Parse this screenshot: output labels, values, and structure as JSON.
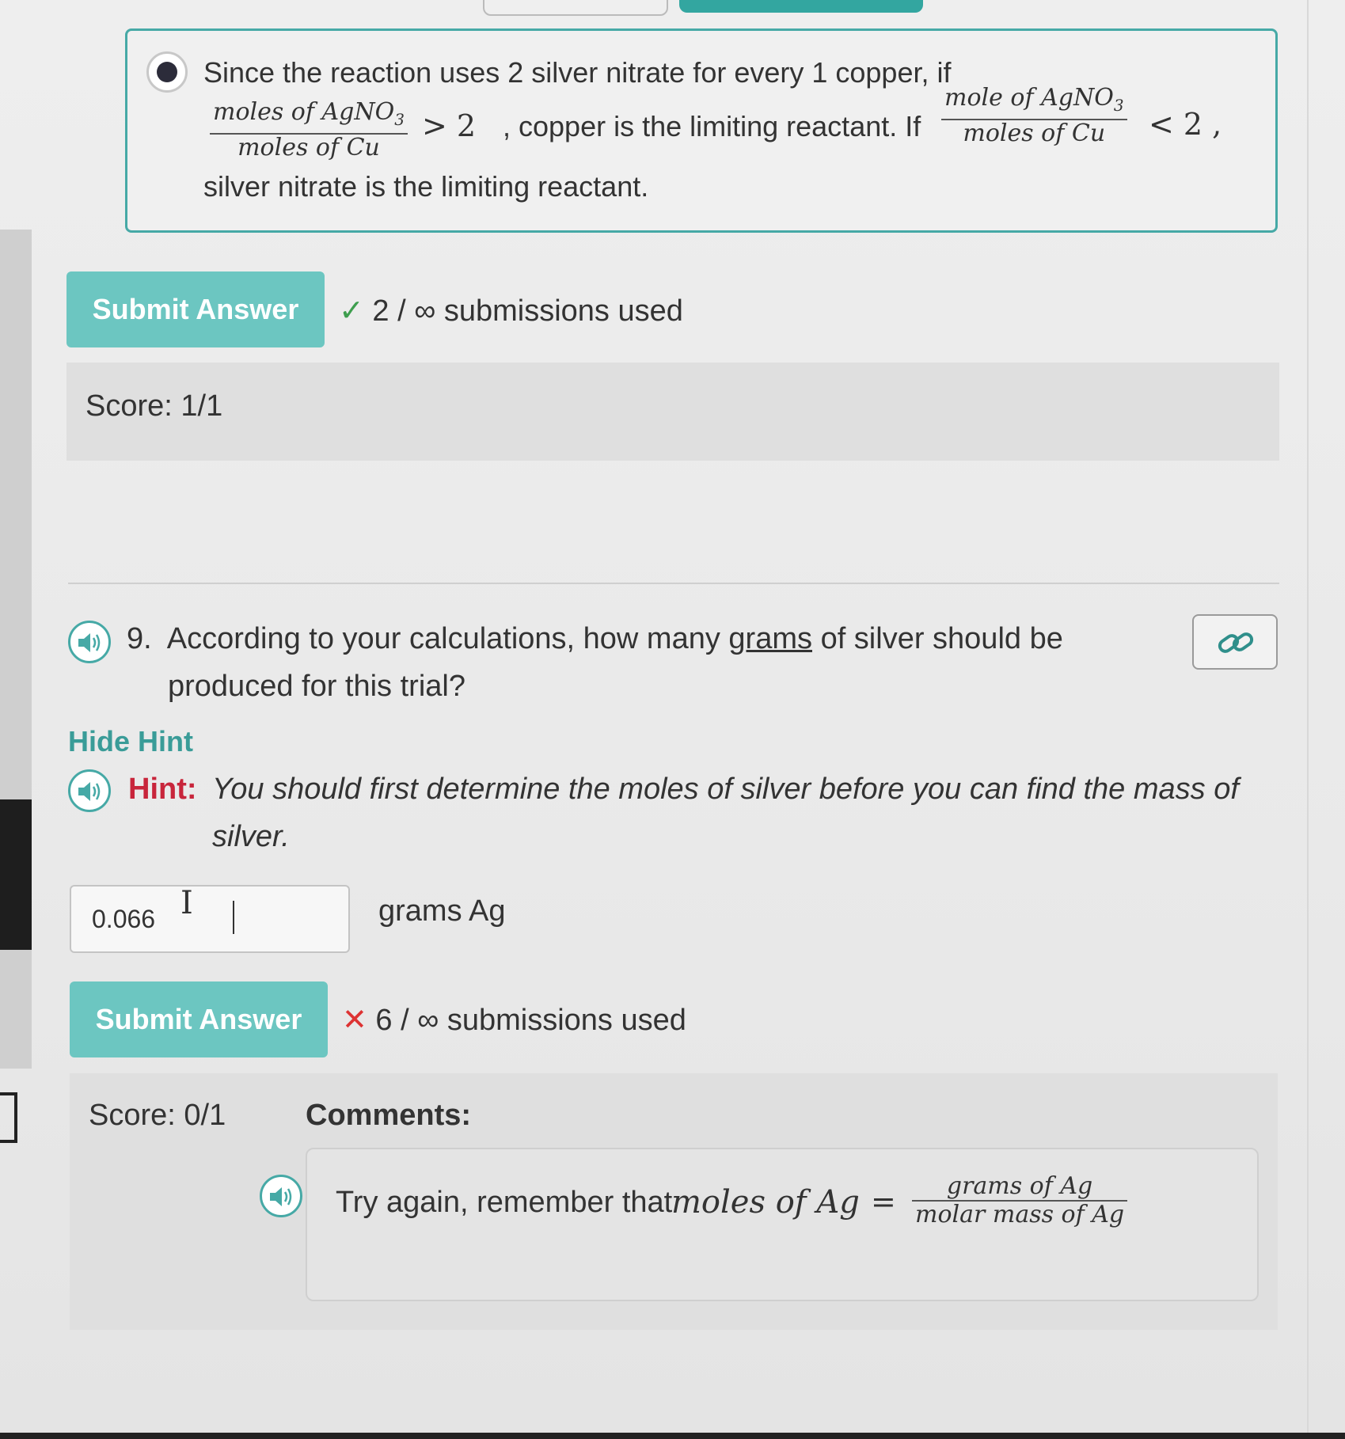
{
  "option": {
    "line1": "Since the reaction uses 2 silver nitrate for every 1 copper, if",
    "frac1_num": "moles of AgNO",
    "frac1_num_sub": "3",
    "frac1_den": "moles of Cu",
    "gt_op": "> 2",
    "mid_text": ", copper is the limiting reactant. If",
    "frac2_num": "mole of AgNO",
    "frac2_num_sub": "3",
    "frac2_den": "moles of Cu",
    "lt_op": "< 2 ,",
    "line3": "silver nitrate is the limiting reactant."
  },
  "q8": {
    "submit_label": "Submit Answer",
    "status_icon": "✓",
    "submissions": "2 / ∞ submissions used",
    "score": "Score:  1/1"
  },
  "q9": {
    "number": "9.",
    "text_before": "According to your calculations, how many",
    "text_underlined": "grams",
    "text_after": "of silver should be",
    "text_line2": "produced for this trial?",
    "hide_hint": "Hide Hint",
    "hint_label": "Hint:",
    "hint_line1": "You should first determine the moles of silver before you can find the mass of",
    "hint_line2": "silver.",
    "input_value": "0.066",
    "unit": "grams Ag",
    "submit_label": "Submit Answer",
    "status_icon": "✕",
    "submissions": "6 / ∞ submissions used",
    "score": "Score:  0/1",
    "comments_label": "Comments:",
    "comment_text": "Try again, remember that",
    "comment_math_lhs": "moles of Ag",
    "comment_eq": "=",
    "comment_frac_num": "grams of Ag",
    "comment_frac_den": "molar mass of Ag"
  },
  "icons": {
    "speaker": "speaker-icon",
    "link": "link-icon"
  },
  "colors": {
    "accent": "#46a9a6",
    "button": "#6cc6c1",
    "hint": "#c8253b",
    "check": "#3e9e4e",
    "error": "#dd3333"
  }
}
